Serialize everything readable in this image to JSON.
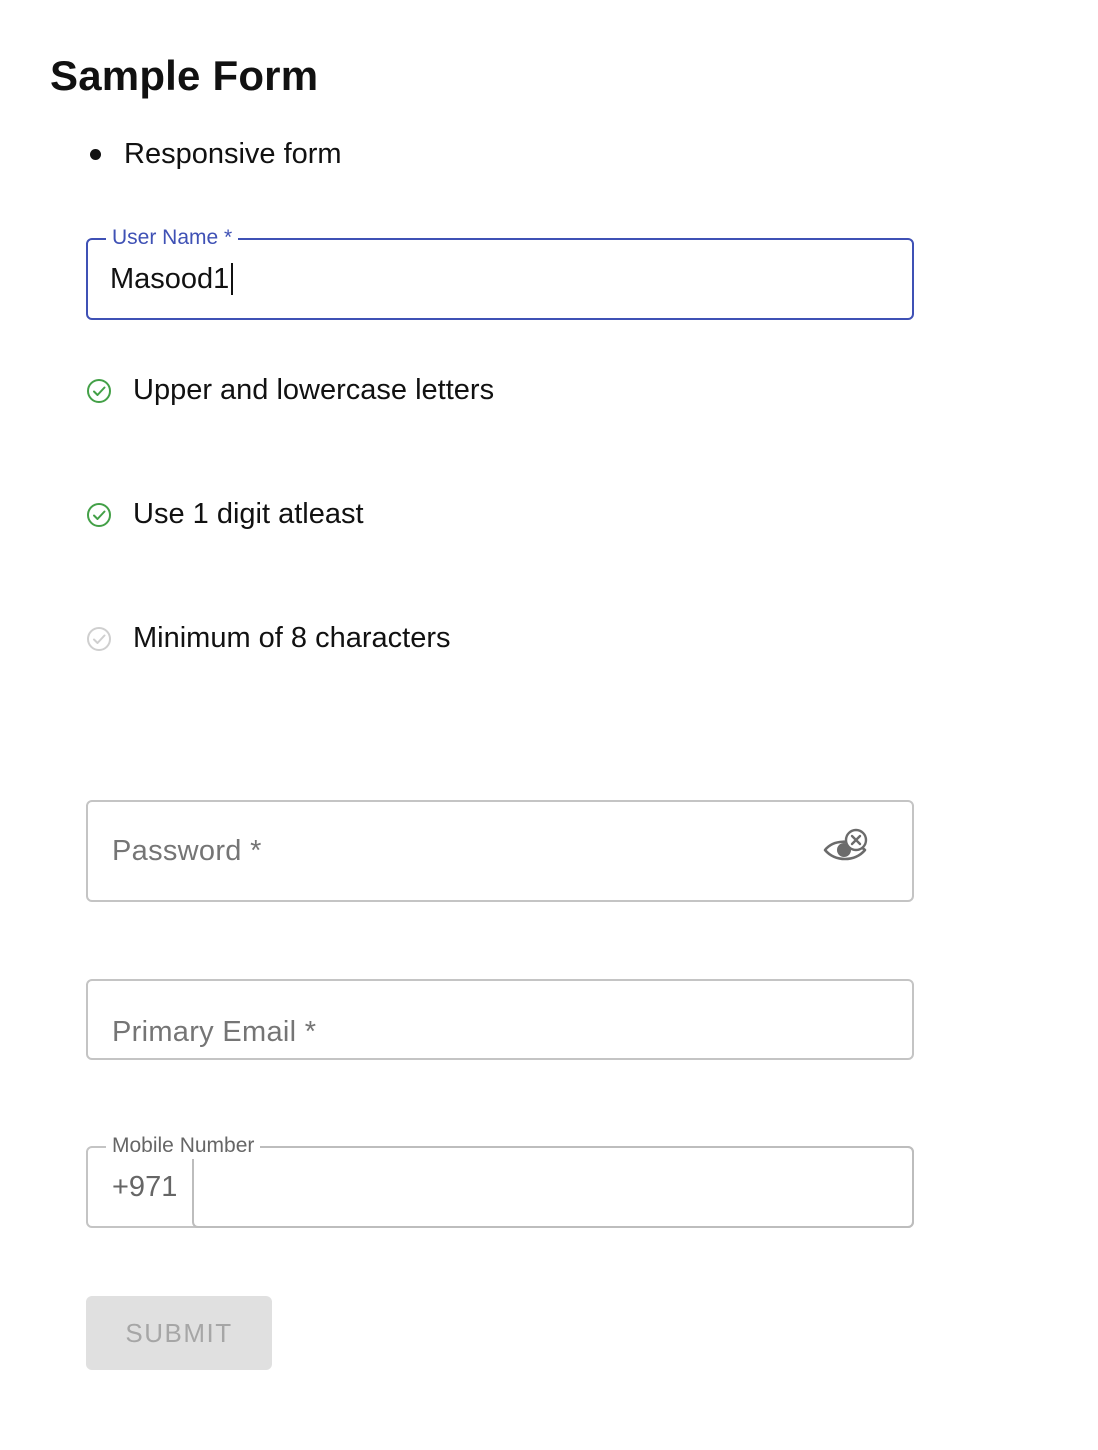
{
  "form": {
    "title": "Sample Form",
    "bullets": [
      "Responsive form"
    ],
    "username": {
      "label": "User Name",
      "required_mark": "*",
      "value": "Masood1"
    },
    "requirements": [
      {
        "label": "Upper and lowercase letters",
        "met": true,
        "icon": "check-circle-icon"
      },
      {
        "label": "Use 1 digit atleast",
        "met": true,
        "icon": "check-circle-icon"
      },
      {
        "label": "Minimum of 8 characters",
        "met": false,
        "icon": "check-circle-icon"
      }
    ],
    "password": {
      "placeholder": "Password",
      "required_mark": "*",
      "toggle_icon": "eye-visibility-off-icon"
    },
    "email": {
      "placeholder": "Primary Email",
      "required_mark": "*"
    },
    "mobile": {
      "label": "Mobile Number",
      "prefix": "+971",
      "value": ""
    },
    "submit_label": "SUBMIT"
  },
  "colors": {
    "focus": "#3f51b5",
    "success": "#43a047",
    "inactive": "#c8c8c8",
    "button_disabled_bg": "#e0e0e0",
    "button_disabled_text": "#a6a6a6"
  }
}
